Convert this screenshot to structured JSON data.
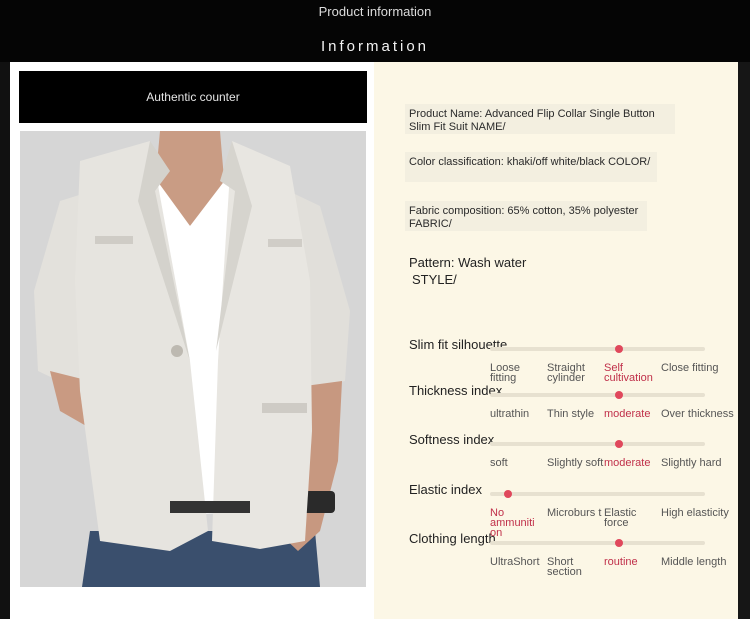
{
  "header": {
    "title": "Product information",
    "subtitle": "Information"
  },
  "counter_label": "Authentic counter",
  "info": {
    "name": "Product Name: Advanced Flip Collar Single Button Slim Fit Suit NAME/",
    "color": "Color classification: khaki/off white/black COLOR/",
    "fabric": "Fabric composition: 65% cotton, 35% polyester FABRIC/",
    "pattern": "Pattern: Wash water",
    "style": "STYLE/"
  },
  "scales": [
    {
      "label": "Slim fit silhouette",
      "selected": 2,
      "options": [
        "Loose fitting",
        "Straight cylinder",
        "Self cultivation",
        "Close fitting"
      ]
    },
    {
      "label": "Thickness index",
      "selected": 2,
      "options": [
        "ultrathin",
        "Thin style",
        "moderate",
        "Over thickness"
      ]
    },
    {
      "label": "Softness index",
      "selected": 2,
      "options": [
        "soft",
        "Slightly soft",
        "moderate",
        "Slightly hard"
      ]
    },
    {
      "label": "Elastic index",
      "selected": 0,
      "options": [
        "No ammuniti on",
        "Microburs t",
        "Elastic force",
        "High elasticity"
      ]
    },
    {
      "label": "Clothing length",
      "selected": 2,
      "options": [
        "UltraShort",
        "Short section",
        "routine",
        "Middle length"
      ]
    }
  ],
  "colors": {
    "accent": "#e0485c",
    "panel": "#fcf7e6",
    "header": "#050505"
  }
}
